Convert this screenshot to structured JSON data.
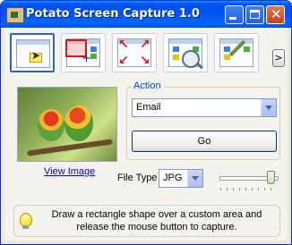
{
  "window": {
    "title": "Potato Screen Capture 1.0"
  },
  "toolbar": {
    "tools": [
      {
        "icon": "select-window-icon",
        "selected": true
      },
      {
        "icon": "select-region-icon"
      },
      {
        "icon": "fullscreen-icon"
      },
      {
        "icon": "zoom-region-icon"
      },
      {
        "icon": "color-picker-icon"
      }
    ],
    "more_label": ">"
  },
  "action": {
    "group_label": "Action",
    "selected": "Email",
    "go_label": "Go"
  },
  "preview": {
    "view_link": "View Image"
  },
  "file_type": {
    "label": "File Type",
    "selected": "JPG"
  },
  "quality_slider": {
    "value": 0.9
  },
  "hint": {
    "text": "Draw a rectangle shape over a custom area and release the mouse button to capture."
  }
}
